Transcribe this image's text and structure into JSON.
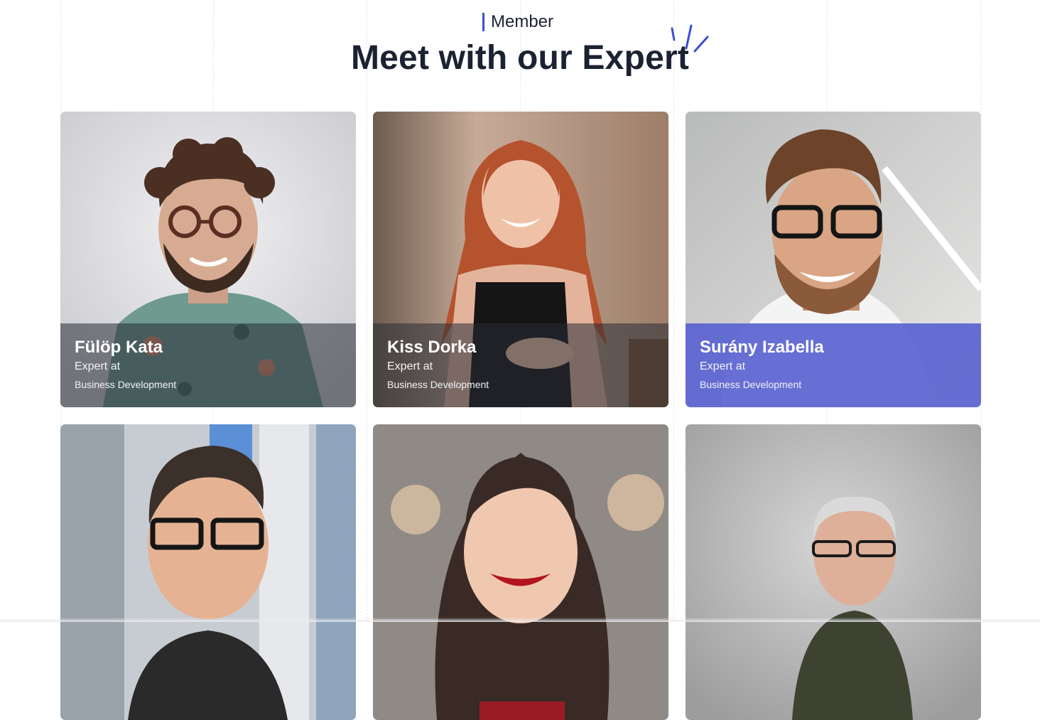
{
  "header": {
    "eyebrow": "Member",
    "title": "Meet with our Expert"
  },
  "colors": {
    "accent": "#3b4fd1",
    "highlight_overlay": "#5860d0",
    "title_text": "#1b2232"
  },
  "members": [
    {
      "name": "Fülöp Kata",
      "role": "Expert at",
      "department": "Business Development",
      "highlighted": false
    },
    {
      "name": "Kiss Dorka",
      "role": "Expert at",
      "department": "Business Development",
      "highlighted": false
    },
    {
      "name": "Surány Izabella",
      "role": "Expert at",
      "department": "Business Development",
      "highlighted": true
    },
    {
      "name": "",
      "role": "",
      "department": "",
      "highlighted": false
    },
    {
      "name": "",
      "role": "",
      "department": "",
      "highlighted": false
    },
    {
      "name": "",
      "role": "",
      "department": "",
      "highlighted": false
    }
  ]
}
